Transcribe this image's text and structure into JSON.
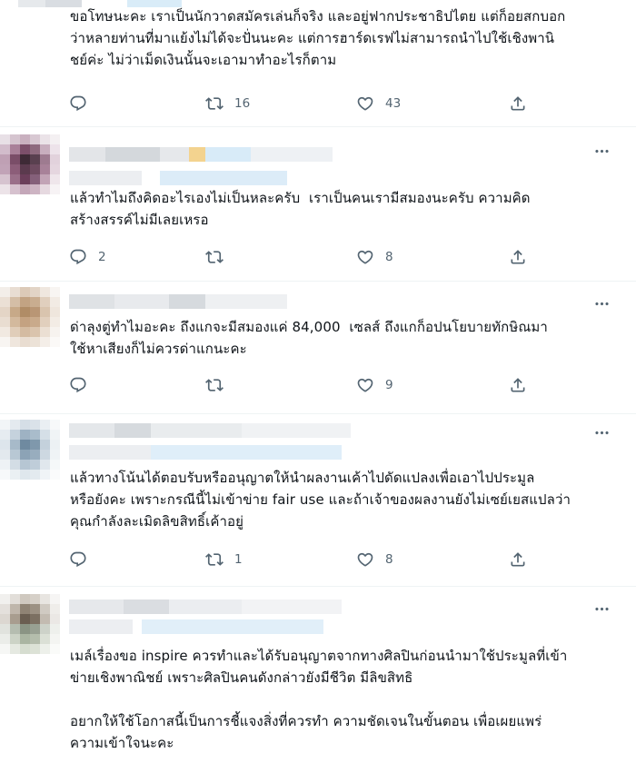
{
  "tweets": [
    {
      "id": "t1",
      "text": "ขอโทษนะคะ เราเป็นนักวาดสมัครเล่นก็จริง และอยู่ฟากประชาธิปไตย แต่ก็อยสกบอก\nว่าหลายท่านที่มาแย้งไม่ได้จะปั่นนะคะ แต่การฮาร์ดเรฟไม่สามารถนำไปใช้เชิงพานิ\nชย์ค่ะ ไม่ว่าเม็ดเงินนั้นจะเอามาทำอะไรก็ตาม",
      "replies": "",
      "retweets": "16",
      "likes": "43"
    },
    {
      "id": "t2",
      "text": "แล้วทำไมถึงคิดอะไรเองไม่เป็นหละครับ  เราเป็นคนเรามีสมองนะครับ ความคิด\nสร้างสรรค์ไม่มีเลยเหรอ",
      "replies": "2",
      "retweets": "",
      "likes": "8"
    },
    {
      "id": "t3",
      "text": "ด่าลุงตู่ทำไมอะคะ ถึงแกจะมีสมองแค่ 84,000  เซลส์ ถึงแกก็อปนโยบายทักษิณมา\nใช้หาเสียงก็ไม่ควรด่าแกนะคะ",
      "replies": "",
      "retweets": "",
      "likes": "9"
    },
    {
      "id": "t4",
      "text": "แล้วทางโน้นได้ตอบรับหรืออนุญาตให้นำผลงานเค้าไปดัดแปลงเพื่อเอาไปประมูล\nหรือยังคะ เพราะกรณีนี้ไม่เข้าข่าย fair use และถ้าเจ้าของผลงานยังไม่เซย์เยสแปลว่า\nคุณกำลังละเมิดลิขสิทธิ์เค้าอยู่",
      "replies": "",
      "retweets": "1",
      "likes": "8"
    },
    {
      "id": "t5",
      "text": "เมล์เรื่องขอ inspire ควรทำและได้รับอนุญาตจากทางศิลปินก่อนนำมาใช้ประมูลที่เข้า\nข่ายเชิงพาณิชย์ เพราะศิลปินคนดังกล่าวยังมีชีวิต มีลิขสิทธิ\n\nอยากให้ใช้โอกาสนี้เป็นการชี้แจงสิ่งที่ควรทำ ความชัดเจนในขั้นตอน เพื่อเผยแพร่\nความเข้าใจนะคะ",
      "replies": "",
      "retweets": "",
      "likes": ""
    }
  ],
  "icons": {
    "reply": "reply-icon",
    "retweet": "retweet-icon",
    "like": "heart-icon",
    "share": "share-icon",
    "more": "more-icon"
  },
  "colors": {
    "text": "#0f1419",
    "secondary": "#536471",
    "divider": "#eff3f4"
  }
}
